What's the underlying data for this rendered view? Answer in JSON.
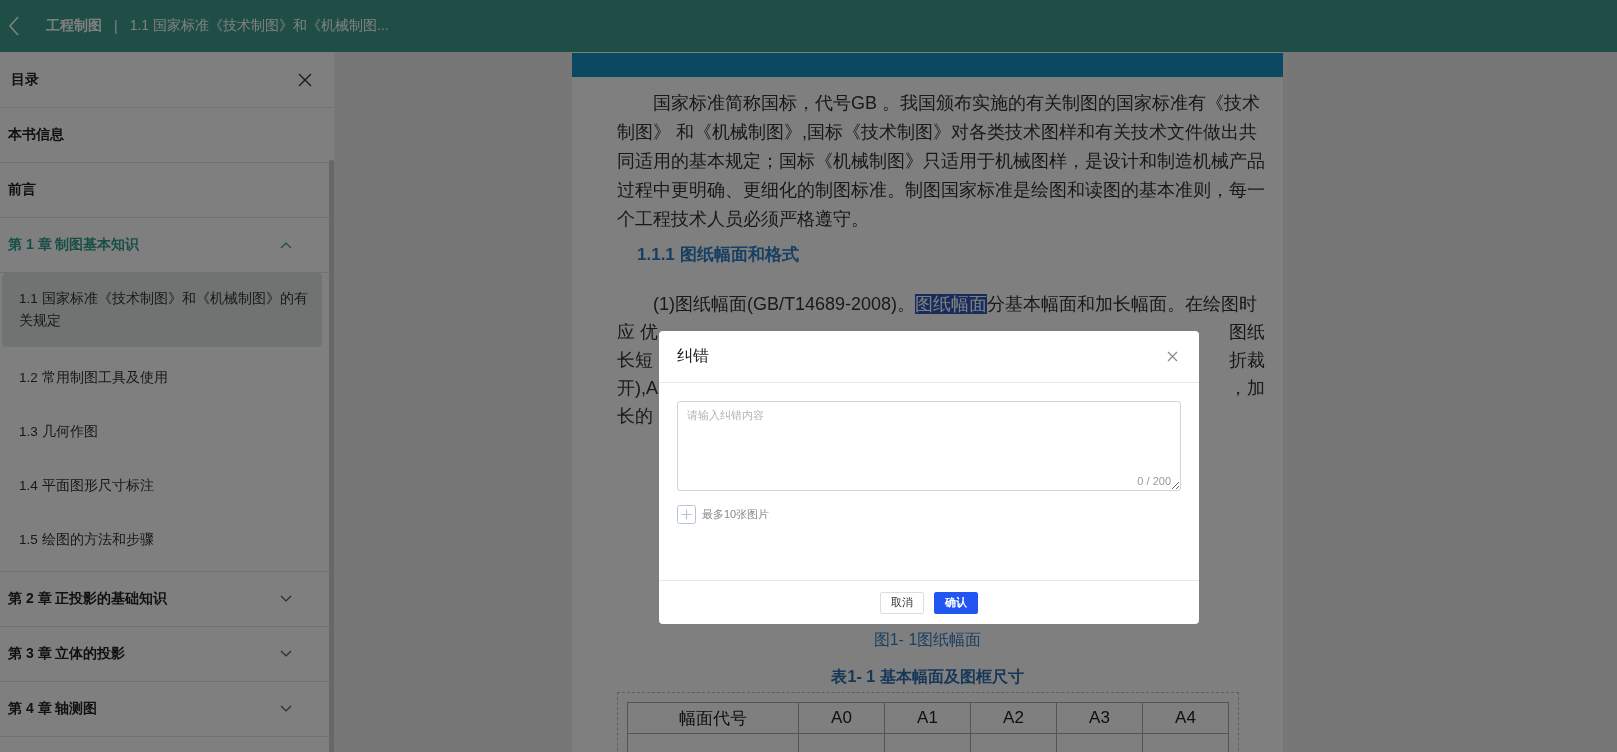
{
  "top_bar": {
    "book_title": "工程制图",
    "separator": "|",
    "chapter_title": "1.1 国家标准《技术制图》和《机械制图..."
  },
  "sidebar": {
    "title": "目录",
    "items": [
      {
        "label": "本书信息",
        "kind": "plain"
      },
      {
        "label": "前言",
        "kind": "plain"
      },
      {
        "label": "第 1 章 制图基本知识",
        "kind": "chapter",
        "expanded": true,
        "children": [
          {
            "label": "1.1 国家标准《技术制图》和《机械制图》的有关规定",
            "selected": true
          },
          {
            "label": "1.2 常用制图工具及使用",
            "selected": false
          },
          {
            "label": "1.3 几何作图",
            "selected": false
          },
          {
            "label": "1.4 平面图形尺寸标注",
            "selected": false
          },
          {
            "label": "1.5 绘图的方法和步骤",
            "selected": false
          }
        ]
      },
      {
        "label": "第 2 章 正投影的基础知识",
        "kind": "chapter",
        "expanded": false
      },
      {
        "label": "第 3 章 立体的投影",
        "kind": "chapter",
        "expanded": false
      },
      {
        "label": "第 4 章 轴测图",
        "kind": "chapter",
        "expanded": false
      }
    ]
  },
  "content": {
    "paragraph_1": "国家标准简称国标，代号GB 。我国颁布实施的有关制图的国家标准有《技术制图》 和《机械制图》,国标《技术制图》对各类技术图样和有关技术文件做出共同适用的基本规定；国标《机械制图》只适用于机械图样，是设计和制造机械产品过程中更明确、更细化的制图标准。制图国家标准是绘图和读图的基本准则，每一个工程技术人员必须严格遵守。",
    "heading": "1.1.1  图纸幅面和格式",
    "paragraph_2_first_line": {
      "before": "(1)图纸幅面(GB/T14689-2008)。",
      "highlighted": "图纸幅面",
      "after": "分基本幅面和加长幅面。在绘图时"
    },
    "paragraph_2_visible_fragments": [
      {
        "left": "应 优",
        "right": "图纸"
      },
      {
        "left": "长短",
        "right": "折裁"
      },
      {
        "left": "开),A",
        "right": "，加"
      },
      {
        "left": "长的"
      }
    ],
    "figure_caption": "图1- 1图纸幅面",
    "table_caption": "表1- 1  基本幅面及图框尺寸",
    "table": {
      "columns": [
        "幅面代号",
        "A0",
        "A1",
        "A2",
        "A3",
        "A4"
      ]
    }
  },
  "dialog": {
    "title": "纠错",
    "textarea": {
      "placeholder": "请输入纠错内容",
      "counter": "0 / 200"
    },
    "upload_hint": "最多10张图片",
    "buttons": [
      {
        "label": "取消",
        "kind": "default"
      },
      {
        "label": "确认",
        "kind": "primary"
      }
    ]
  }
}
